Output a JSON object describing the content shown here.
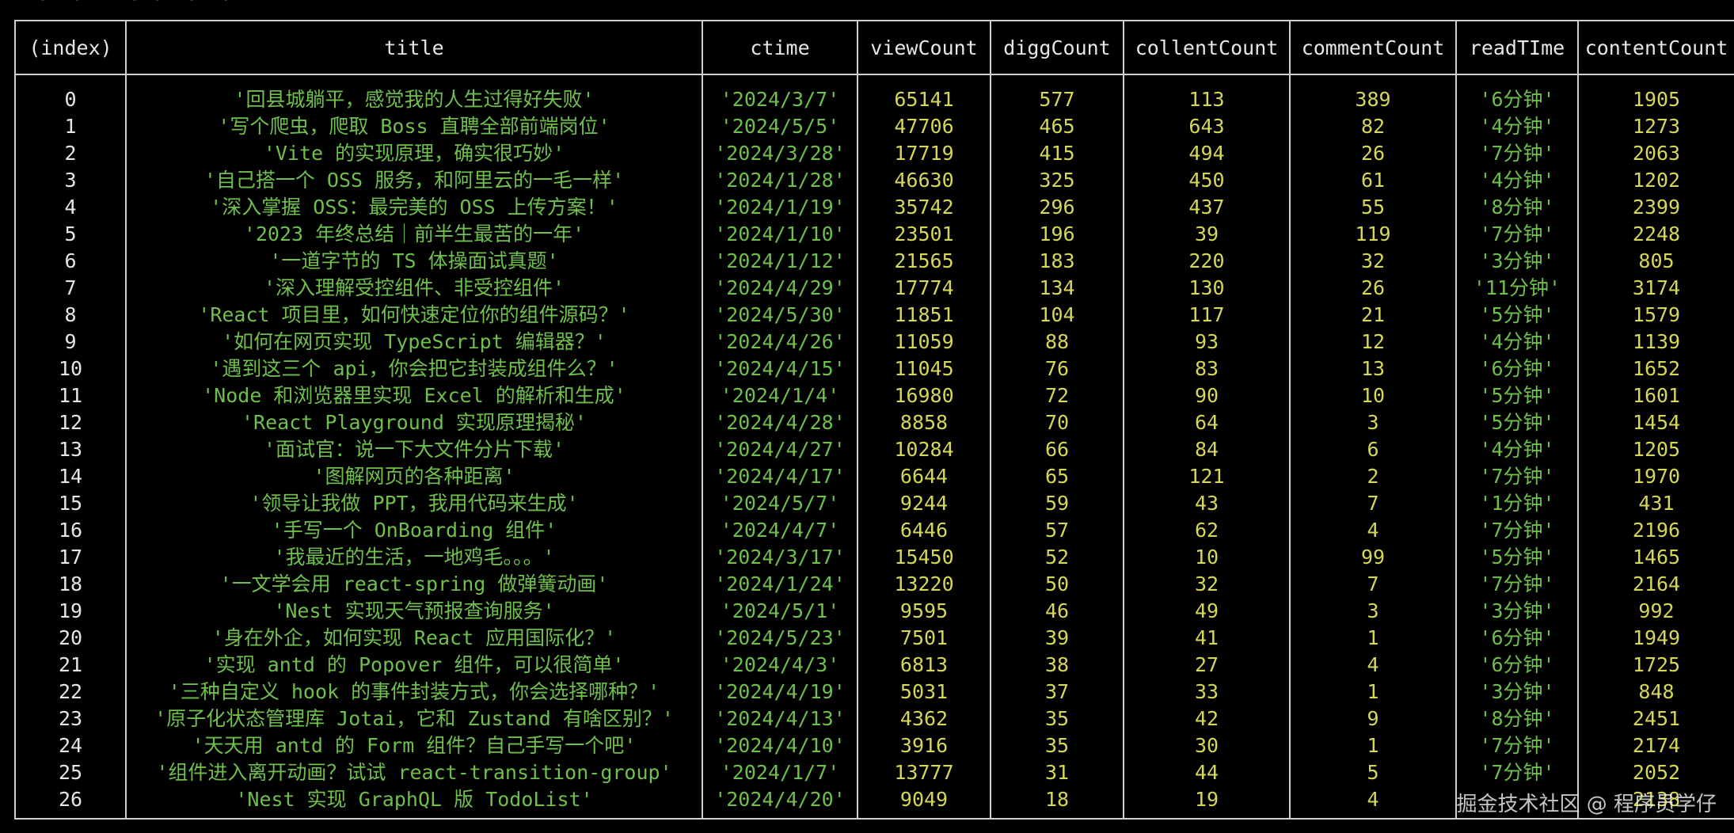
{
  "terminal": {
    "top_fragment": "  •  •    • •  •  •"
  },
  "table": {
    "headers": [
      "(index)",
      "title",
      "ctime",
      "viewCount",
      "diggCount",
      "collentCount",
      "commentCount",
      "readTIme",
      "contentCount"
    ],
    "rows": [
      [
        "0",
        "'回县城躺平，感觉我的人生过得好失败'",
        "'2024/3/7'",
        "65141",
        "577",
        "113",
        "389",
        "'6分钟'",
        "1905"
      ],
      [
        "1",
        "'写个爬虫，爬取 Boss 直聘全部前端岗位'",
        "'2024/5/5'",
        "47706",
        "465",
        "643",
        "82",
        "'4分钟'",
        "1273"
      ],
      [
        "2",
        "'Vite 的实现原理，确实很巧妙'",
        "'2024/3/28'",
        "17719",
        "415",
        "494",
        "26",
        "'7分钟'",
        "2063"
      ],
      [
        "3",
        "'自己搭一个 OSS 服务，和阿里云的一毛一样'",
        "'2024/1/28'",
        "46630",
        "325",
        "450",
        "61",
        "'4分钟'",
        "1202"
      ],
      [
        "4",
        "'深入掌握 OSS：最完美的 OSS 上传方案！'",
        "'2024/1/19'",
        "35742",
        "296",
        "437",
        "55",
        "'8分钟'",
        "2399"
      ],
      [
        "5",
        "'2023 年终总结｜前半生最苦的一年'",
        "'2024/1/10'",
        "23501",
        "196",
        "39",
        "119",
        "'7分钟'",
        "2248"
      ],
      [
        "6",
        "'一道字节的 TS 体操面试真题'",
        "'2024/1/12'",
        "21565",
        "183",
        "220",
        "32",
        "'3分钟'",
        "805"
      ],
      [
        "7",
        "'深入理解受控组件、非受控组件'",
        "'2024/4/29'",
        "17774",
        "134",
        "130",
        "26",
        "'11分钟'",
        "3174"
      ],
      [
        "8",
        "'React 项目里，如何快速定位你的组件源码？'",
        "'2024/5/30'",
        "11851",
        "104",
        "117",
        "21",
        "'5分钟'",
        "1579"
      ],
      [
        "9",
        "'如何在网页实现 TypeScript 编辑器？'",
        "'2024/4/26'",
        "11059",
        "88",
        "93",
        "12",
        "'4分钟'",
        "1139"
      ],
      [
        "10",
        "'遇到这三个 api，你会把它封装成组件么？'",
        "'2024/4/15'",
        "11045",
        "76",
        "83",
        "13",
        "'6分钟'",
        "1652"
      ],
      [
        "11",
        "'Node 和浏览器里实现 Excel 的解析和生成'",
        "'2024/1/4'",
        "16980",
        "72",
        "90",
        "10",
        "'5分钟'",
        "1601"
      ],
      [
        "12",
        "'React Playground 实现原理揭秘'",
        "'2024/4/28'",
        "8858",
        "70",
        "64",
        "3",
        "'5分钟'",
        "1454"
      ],
      [
        "13",
        "'面试官：说一下大文件分片下载'",
        "'2024/4/27'",
        "10284",
        "66",
        "84",
        "6",
        "'4分钟'",
        "1205"
      ],
      [
        "14",
        "'图解网页的各种距离'",
        "'2024/4/17'",
        "6644",
        "65",
        "121",
        "2",
        "'7分钟'",
        "1970"
      ],
      [
        "15",
        "'领导让我做 PPT，我用代码来生成'",
        "'2024/5/7'",
        "9244",
        "59",
        "43",
        "7",
        "'1分钟'",
        "431"
      ],
      [
        "16",
        "'手写一个 OnBoarding 组件'",
        "'2024/4/7'",
        "6446",
        "57",
        "62",
        "4",
        "'7分钟'",
        "2196"
      ],
      [
        "17",
        "'我最近的生活，一地鸡毛。。。'",
        "'2024/3/17'",
        "15450",
        "52",
        "10",
        "99",
        "'5分钟'",
        "1465"
      ],
      [
        "18",
        "'一文学会用 react-spring 做弹簧动画'",
        "'2024/1/24'",
        "13220",
        "50",
        "32",
        "7",
        "'7分钟'",
        "2164"
      ],
      [
        "19",
        "'Nest 实现天气预报查询服务'",
        "'2024/5/1'",
        "9595",
        "46",
        "49",
        "3",
        "'3分钟'",
        "992"
      ],
      [
        "20",
        "'身在外企，如何实现 React 应用国际化？'",
        "'2024/5/23'",
        "7501",
        "39",
        "41",
        "1",
        "'6分钟'",
        "1949"
      ],
      [
        "21",
        "'实现 antd 的 Popover 组件，可以很简单'",
        "'2024/4/3'",
        "6813",
        "38",
        "27",
        "4",
        "'6分钟'",
        "1725"
      ],
      [
        "22",
        "'三种自定义 hook 的事件封装方式，你会选择哪种？'",
        "'2024/4/19'",
        "5031",
        "37",
        "33",
        "1",
        "'3分钟'",
        "848"
      ],
      [
        "23",
        "'原子化状态管理库 Jotai，它和 Zustand 有啥区别？'",
        "'2024/4/13'",
        "4362",
        "35",
        "42",
        "9",
        "'8分钟'",
        "2451"
      ],
      [
        "24",
        "'天天用 antd 的 Form 组件？自己手写一个吧'",
        "'2024/4/10'",
        "3916",
        "35",
        "30",
        "1",
        "'7分钟'",
        "2174"
      ],
      [
        "25",
        "'组件进入离开动画？试试 react-transition-group'",
        "'2024/1/7'",
        "13777",
        "31",
        "44",
        "5",
        "'7分钟'",
        "2052"
      ],
      [
        "26",
        "'Nest 实现 GraphQL 版 TodoList'",
        "'2024/4/20'",
        "9049",
        "18",
        "19",
        "4",
        "",
        "2138"
      ]
    ]
  },
  "watermark": "掘金技术社区 @ 程序员学仔"
}
